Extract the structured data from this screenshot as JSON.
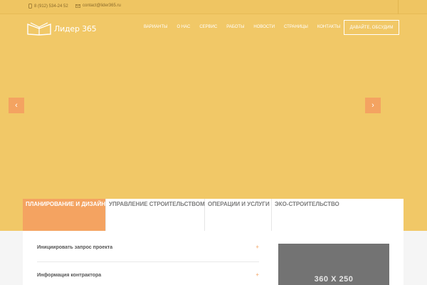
{
  "topbar": {
    "phone_icon": "phone-icon",
    "phone": "8 (912) 534-24 52",
    "email_icon": "envelope-icon",
    "email": "contact@lider365.ru"
  },
  "header": {
    "logo_icon": "book-logo-icon",
    "brand": "Лидер 365",
    "nav": [
      "Варианты",
      "О нас",
      "Сервис",
      "Работы",
      "Новости",
      "Страницы",
      "Контакты"
    ],
    "cta": "Давайте, обсудим"
  },
  "slider": {
    "prev": "‹",
    "next": "›"
  },
  "tabs": [
    {
      "label": "Планирование и дизайн",
      "active": true
    },
    {
      "label": "Управление строительством",
      "active": false
    },
    {
      "label": "Операции и услуги",
      "active": false
    },
    {
      "label": "Эко-строительство",
      "active": false
    }
  ],
  "accordion": [
    {
      "label": "Инициировать запрос проекта",
      "toggle": "+"
    },
    {
      "label": "Информация контрактора",
      "toggle": "+"
    }
  ],
  "placeholder": {
    "text": "360 X 250"
  },
  "colors": {
    "hero": "#f1c867",
    "accent": "#f4a361",
    "placeholder": "#737373"
  }
}
